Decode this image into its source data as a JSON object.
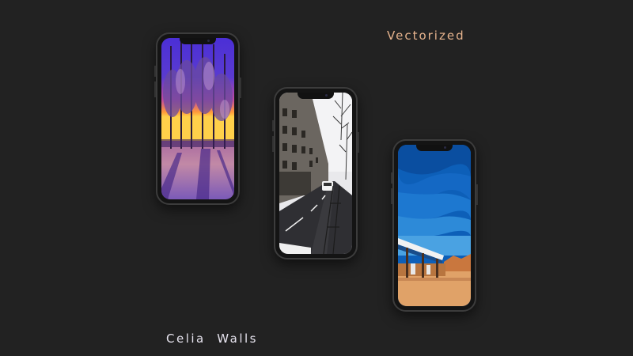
{
  "header": {
    "vectorized_label": "Vectorized"
  },
  "footer": {
    "brand_label": "Celia  Walls"
  },
  "colors": {
    "background": "#222222",
    "vectorized_text": "#e7b48e",
    "brand_text": "#e6e3ee"
  },
  "phones": [
    {
      "wallpaper": "snowy-forest-sunset"
    },
    {
      "wallpaper": "city-street-buildings"
    },
    {
      "wallpaper": "gas-station-blue-sky"
    }
  ]
}
